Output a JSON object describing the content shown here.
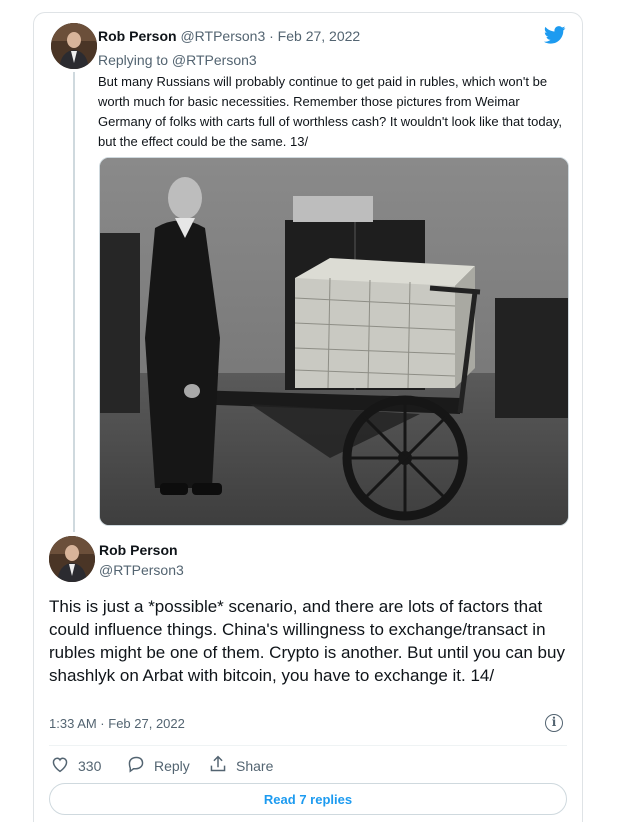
{
  "tweet1": {
    "name": "Rob Person",
    "handle": "@RTPerson3",
    "date": "· Feb 27, 2022",
    "replying_to": "Replying to @RTPerson3",
    "text": "But many Russians will probably continue to get paid in rubles, which won't be worth much for basic necessities. Remember those pictures from Weimar Germany of folks with carts full of worthless cash? It wouldn't look like that today, but the effect could be the same. 13/"
  },
  "tweet2": {
    "name": "Rob Person",
    "handle": "@RTPerson3",
    "text": "This is just a *possible* scenario, and there are lots of factors that could influence things. China's willingness to exchange/transact in rubles might be one of them. Crypto is another. But until you can buy shashlyk on Arbat with bitcoin, you have to exchange it. 14/",
    "timestamp": "1:33 AM · Feb 27, 2022"
  },
  "actions": {
    "like_count": "330",
    "reply_label": "Reply",
    "share_label": "Share"
  },
  "read_replies_label": "Read 7 replies",
  "icons": [
    "twitter-bird-icon",
    "info-icon",
    "heart-icon",
    "reply-bubble-icon",
    "share-icon"
  ],
  "colors": {
    "accent": "#1d9bf0",
    "muted": "#536471",
    "border": "#cfd9de"
  }
}
